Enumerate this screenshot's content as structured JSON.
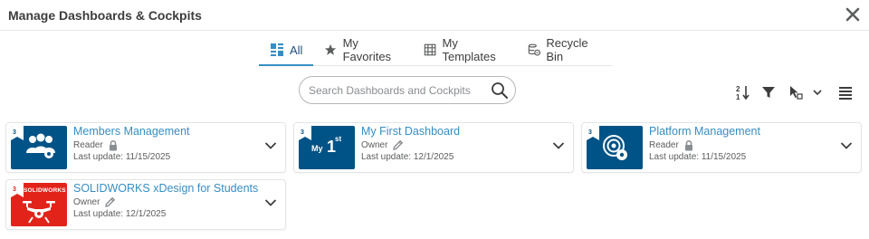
{
  "dialog": {
    "title": "Manage Dashboards & Cockpits",
    "close_icon": "close-icon"
  },
  "tabs": [
    {
      "label": "All",
      "icon": "grid-dashboard-icon",
      "active": true
    },
    {
      "label": "My Favorites",
      "icon": "star-icon",
      "active": false
    },
    {
      "label": "My Templates",
      "icon": "template-grid-icon",
      "active": false
    },
    {
      "label": "Recycle Bin",
      "icon": "recycle-bin-icon",
      "active": false
    }
  ],
  "search": {
    "placeholder": "Search Dashboards and Cockpits",
    "value": "",
    "icon": "search-icon"
  },
  "toolbar": {
    "icons": [
      "sort-icon",
      "filter-icon",
      "select-cursor-icon",
      "chevron-down-icon",
      "list-view-icon"
    ]
  },
  "cards": [
    {
      "title": "Members Management",
      "role": "Reader",
      "role_icon": "lock-icon",
      "updated": "Last update: 11/15/2025",
      "thumb_color": "#005386",
      "thumb_icon": "members-icon"
    },
    {
      "title": "My First Dashboard",
      "role": "Owner",
      "role_icon": "pencil-icon",
      "updated": "Last update: 12/1/2025",
      "thumb_color": "#005386",
      "thumb_text": "My",
      "thumb_text2": "1",
      "thumb_sup": "st"
    },
    {
      "title": "Platform Management",
      "role": "Reader",
      "role_icon": "lock-icon",
      "updated": "Last update: 11/15/2025",
      "thumb_color": "#005386",
      "thumb_icon": "platform-gear-icon"
    },
    {
      "title": "SOLIDWORKS xDesign for Students",
      "role": "Owner",
      "role_icon": "pencil-icon",
      "updated": "Last update: 12/1/2025",
      "thumb_color": "#e2231a",
      "thumb_text": "SOLIDWORKS",
      "thumb_icon": "drone-icon"
    }
  ],
  "colors": {
    "accent": "#368ec4",
    "tile_blue": "#005386",
    "tile_red": "#e2231a"
  }
}
